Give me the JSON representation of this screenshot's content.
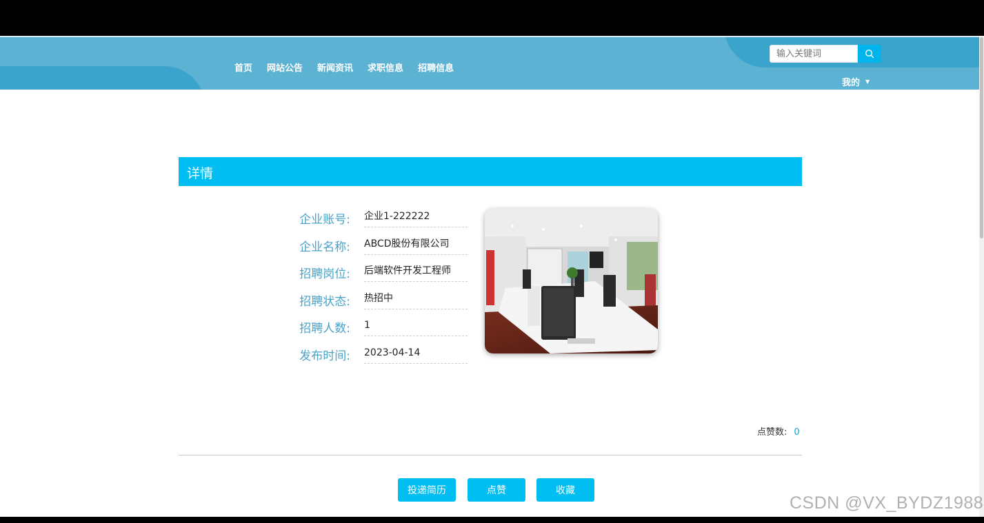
{
  "header": {
    "nav": [
      "首页",
      "网站公告",
      "新闻资讯",
      "求职信息",
      "招聘信息"
    ],
    "search_placeholder": "输入关键词",
    "user_menu_label": "我的",
    "bg_color": "#5bb2d3"
  },
  "detail": {
    "section_title": "详情",
    "fields": [
      {
        "label": "企业账号:",
        "value": "企业1-222222"
      },
      {
        "label": "企业名称:",
        "value": "ABCD股份有限公司"
      },
      {
        "label": "招聘岗位:",
        "value": "后端软件开发工程师"
      },
      {
        "label": "招聘状态:",
        "value": "热招中"
      },
      {
        "label": "招聘人数:",
        "value": "1"
      },
      {
        "label": "发布时间:",
        "value": "2023-04-14"
      }
    ],
    "likes_label": "点赞数:",
    "likes_count": "0",
    "accent_color": "#00bdf2"
  },
  "actions": {
    "apply_label": "投递简历",
    "like_label": "点赞",
    "favorite_label": "收藏"
  },
  "watermark": "CSDN @VX_BYDZ1988"
}
